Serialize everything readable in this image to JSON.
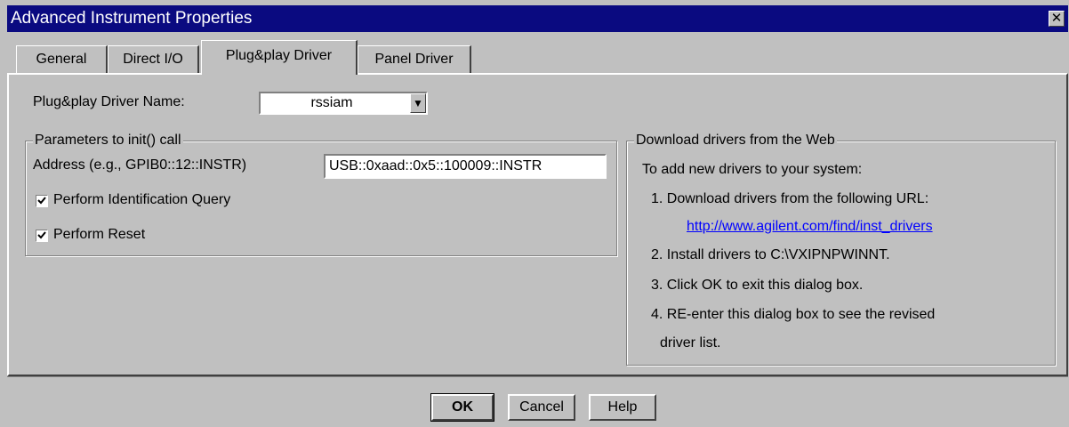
{
  "window": {
    "title": "Advanced Instrument Properties",
    "close_glyph": "✕"
  },
  "tabs": [
    {
      "label": "General",
      "active": false
    },
    {
      "label": "Direct I/O",
      "active": false
    },
    {
      "label": "Plug&play Driver",
      "active": true
    },
    {
      "label": "Panel Driver",
      "active": false
    }
  ],
  "driver": {
    "name_label": "Plug&play Driver Name:",
    "name_value": "rssiam",
    "dropdown_glyph": "▼"
  },
  "init_params": {
    "legend": "Parameters to init() call",
    "address_label": "Address (e.g., GPIB0::12::INSTR)",
    "address_value": "USB::0xaad::0x5::100009::INSTR",
    "id_query_label": "Perform Identification Query",
    "id_query_checked": true,
    "reset_label": "Perform Reset",
    "reset_checked": true
  },
  "download": {
    "legend": "Download drivers from the Web",
    "intro": "To add new drivers to your system:",
    "step1": "1. Download drivers from the following URL:",
    "url": "http://www.agilent.com/find/inst_drivers",
    "step2": "2. Install drivers to C:\\VXIPNPWINNT.",
    "step3": "3. Click OK to exit this dialog box.",
    "step4_line1": "4. RE-enter this dialog box to see the revised",
    "step4_line2": "driver list."
  },
  "buttons": {
    "ok": "OK",
    "cancel": "Cancel",
    "help": "Help"
  }
}
